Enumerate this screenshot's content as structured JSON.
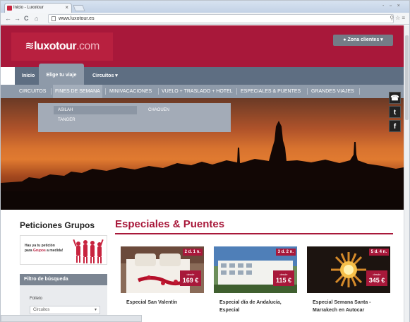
{
  "browser": {
    "tab_title": "Inicio - Luxotour",
    "tab_close": "×",
    "url": "www.luxotour.es",
    "back": "←",
    "forward": "→",
    "reload": "C",
    "home": "⌂",
    "toolbar_icons": "⚲☆≡",
    "window_controls": "- ▫ ×"
  },
  "header": {
    "logo_prefix": "≋",
    "logo_main": "luxotour",
    "logo_suffix": ".com",
    "zona_label": "Zona clientes ▾",
    "brand_color": "#a8183a"
  },
  "mainnav": {
    "items": [
      {
        "label": "Inicio"
      },
      {
        "label": "Elige tu viaje"
      },
      {
        "label": "Circuitos ▾"
      }
    ]
  },
  "subnav": {
    "items": [
      {
        "label": "CIRCUITOS"
      },
      {
        "label": "FINES DE SEMANA"
      },
      {
        "label": "MINIVACACIONES"
      },
      {
        "label": "VUELO + TRASLADO + HOTEL"
      },
      {
        "label": "ESPECIALES & PUENTES"
      },
      {
        "label": "GRANDES VIAJES"
      }
    ]
  },
  "dropdown": {
    "items": [
      {
        "label": "ASILAH"
      },
      {
        "label": "TANGER"
      },
      {
        "label": "CHAOUEN"
      }
    ]
  },
  "social": [
    {
      "icon": "phone-icon",
      "glyph": "☎"
    },
    {
      "icon": "twitter-icon",
      "glyph": "t"
    },
    {
      "icon": "facebook-icon",
      "glyph": "f"
    }
  ],
  "sidebar": {
    "title": "Peticiones Grupos",
    "banner_line1": "Has ya tu petición",
    "banner_line2_pre": "para ",
    "banner_line2_hl": "Grupos",
    "banner_line2_post": " a medida!",
    "filter_header": "Filtro de búsqueda",
    "filter_label": "Folleto",
    "filter_value": "Circuitos",
    "filter_chevron": "▾"
  },
  "main": {
    "title": "Especiales & Puentes",
    "cards": [
      {
        "duration": "2 d. 1 n.",
        "price_prefix": "desde",
        "price": "169 €",
        "name": "Especial San Valentín"
      },
      {
        "duration": "3 d. 2 n.",
        "price_prefix": "desde",
        "price": "115 €",
        "name": "Especial día de Andalucía, Especial"
      },
      {
        "duration": "5 d. 4 n.",
        "price_prefix": "desde",
        "price": "345 €",
        "name": "Especial Semana Santa - Marrakech en Autocar"
      }
    ]
  }
}
